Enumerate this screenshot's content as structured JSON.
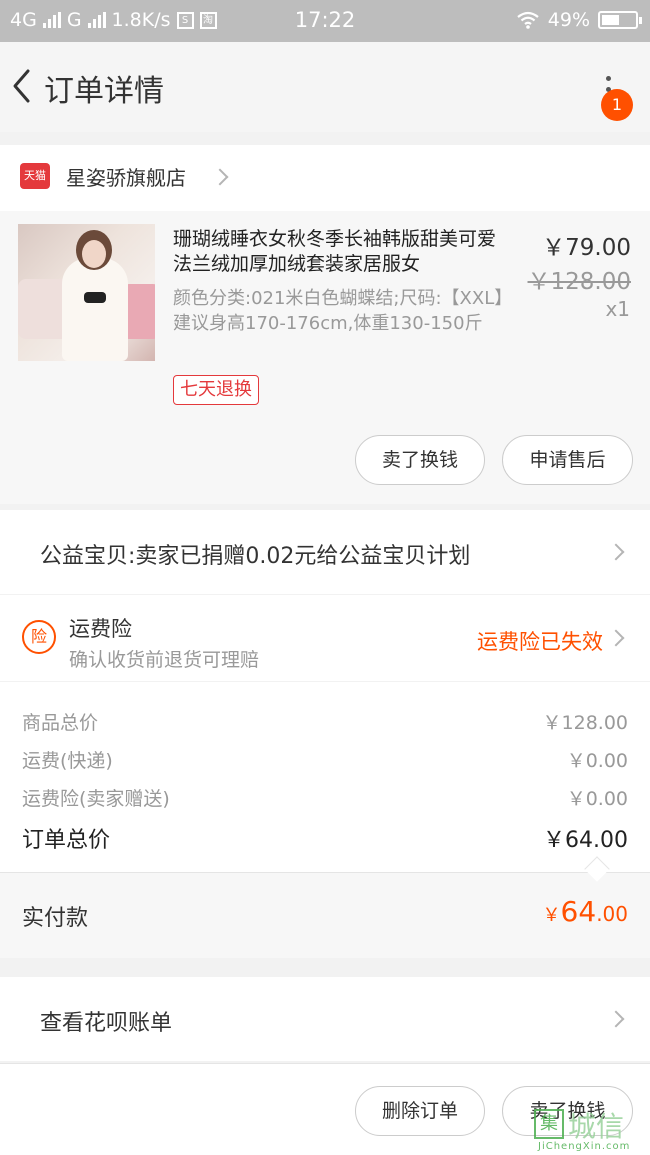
{
  "status_bar": {
    "network1": "4G",
    "network2": "G",
    "speed": "1.8K/s",
    "s_icon": "S",
    "tao_icon": "淘",
    "time": "17:22",
    "battery": "49%"
  },
  "header": {
    "title": "订单详情",
    "badge_count": "1"
  },
  "shop": {
    "tmall_badge": "天猫",
    "name": "星姿骄旗舰店"
  },
  "product": {
    "title": "珊瑚绒睡衣女秋冬季长袖韩版甜美可爱法兰绒加厚加绒套装家居服女",
    "sku": "颜色分类:021米白色蝴蝶结;尺码:【XXL】建议身高170-176cm,体重130-150斤",
    "tag": "七天退换",
    "price": "￥79.00",
    "original_price": "￥128.00",
    "quantity": "x1",
    "buttons": {
      "sell": "卖了换钱",
      "after_sale": "申请售后"
    }
  },
  "charity": {
    "text": "公益宝贝:卖家已捐赠0.02元给公益宝贝计划"
  },
  "insurance": {
    "icon": "险",
    "title": "运费险",
    "subtitle": "确认收货前退货可理赔",
    "status": "运费险已失效"
  },
  "totals": {
    "goods_label": "商品总价",
    "goods_value": "￥128.00",
    "shipping_label": "运费(快递)",
    "shipping_value": "￥0.00",
    "ins_label": "运费险(卖家赠送)",
    "ins_value": "￥0.00",
    "order_total_label": "订单总价",
    "order_total_value": "￥64.00"
  },
  "paid": {
    "label": "实付款",
    "currency": "￥",
    "integer": "64",
    "decimal": ".00"
  },
  "huabei": {
    "text": "查看花呗账单"
  },
  "bottom_bar": {
    "delete": "删除订单",
    "sell": "卖了换钱"
  },
  "watermark": {
    "cn": "城信",
    "en": "JiChengXin.com",
    "logo": "集"
  },
  "colors": {
    "accent": "#ff5000",
    "tmall_red": "#e4393c",
    "status_bar": "#bdbdbd"
  }
}
